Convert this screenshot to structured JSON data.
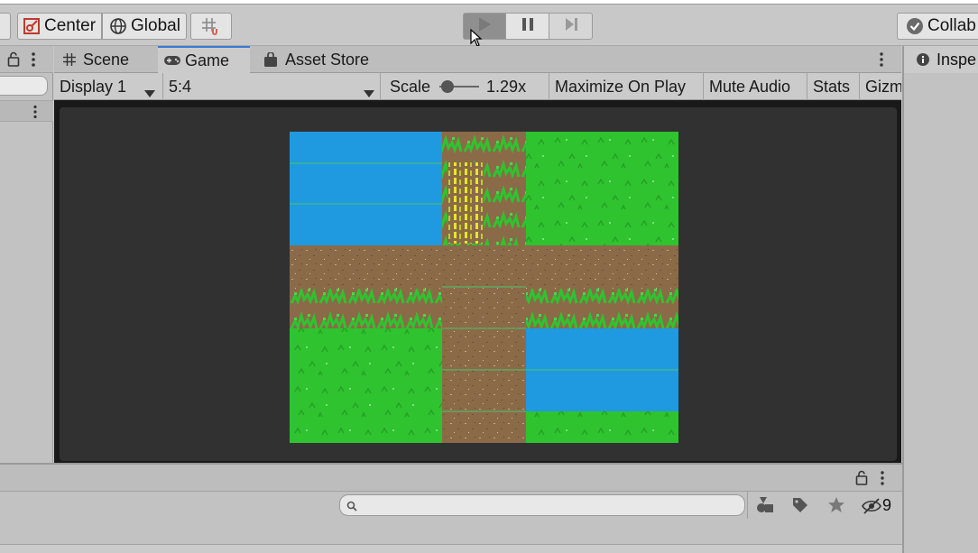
{
  "toolbar": {
    "pivot_label": "Center",
    "space_label": "Global",
    "collab_label": "Collab"
  },
  "tabs": [
    {
      "label": "Scene",
      "icon": "grid-icon"
    },
    {
      "label": "Game",
      "icon": "gamepad-icon"
    },
    {
      "label": "Asset Store",
      "icon": "bag-icon"
    }
  ],
  "right_tab": {
    "label": "Inspe",
    "icon": "info-icon"
  },
  "game_toolbar": {
    "display": "Display 1",
    "aspect": "5:4",
    "scale_label": "Scale",
    "scale_value": "1.29x",
    "maximize": "Maximize On Play",
    "mute": "Mute Audio",
    "stats": "Stats",
    "gizmos": "Gizm"
  },
  "bottom": {
    "hidden_count": "9"
  },
  "colors": {
    "water": "#1f9ae0",
    "grass": "#2fc32f",
    "dirt": "#8b6a48",
    "accent": "#3a79d4"
  }
}
